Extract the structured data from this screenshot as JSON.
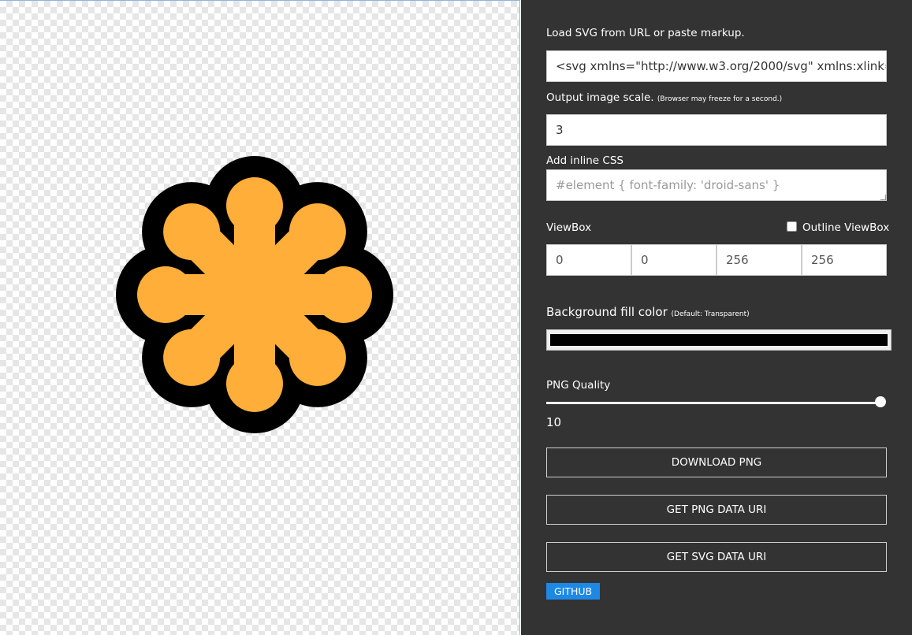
{
  "source": {
    "label": "Load SVG from URL or paste markup.",
    "value": "<svg xmlns=\"http://www.w3.org/2000/svg\" xmlns:xlink=\""
  },
  "scale": {
    "label": "Output image scale.",
    "note": "(Browser may freeze for a second.)",
    "value": "3"
  },
  "css": {
    "label": "Add inline CSS",
    "placeholder": "#element { font-family: 'droid-sans' }"
  },
  "viewbox": {
    "label": "ViewBox",
    "outline_label": "Outline ViewBox",
    "outline_checked": false,
    "values": [
      "0",
      "0",
      "256",
      "256"
    ]
  },
  "background": {
    "label": "Background fill color",
    "note": "(Default: Transparent)",
    "color": "#000000"
  },
  "quality": {
    "label": "PNG Quality",
    "value": "10",
    "max": 10
  },
  "buttons": {
    "download_png": "DOWNLOAD PNG",
    "png_uri": "GET PNG DATA URI",
    "svg_uri": "GET SVG DATA URI",
    "github": "GITHUB"
  },
  "preview": {
    "fill": "#ffae39",
    "outline": "#000000",
    "icon": "asterisk-flower-icon"
  }
}
